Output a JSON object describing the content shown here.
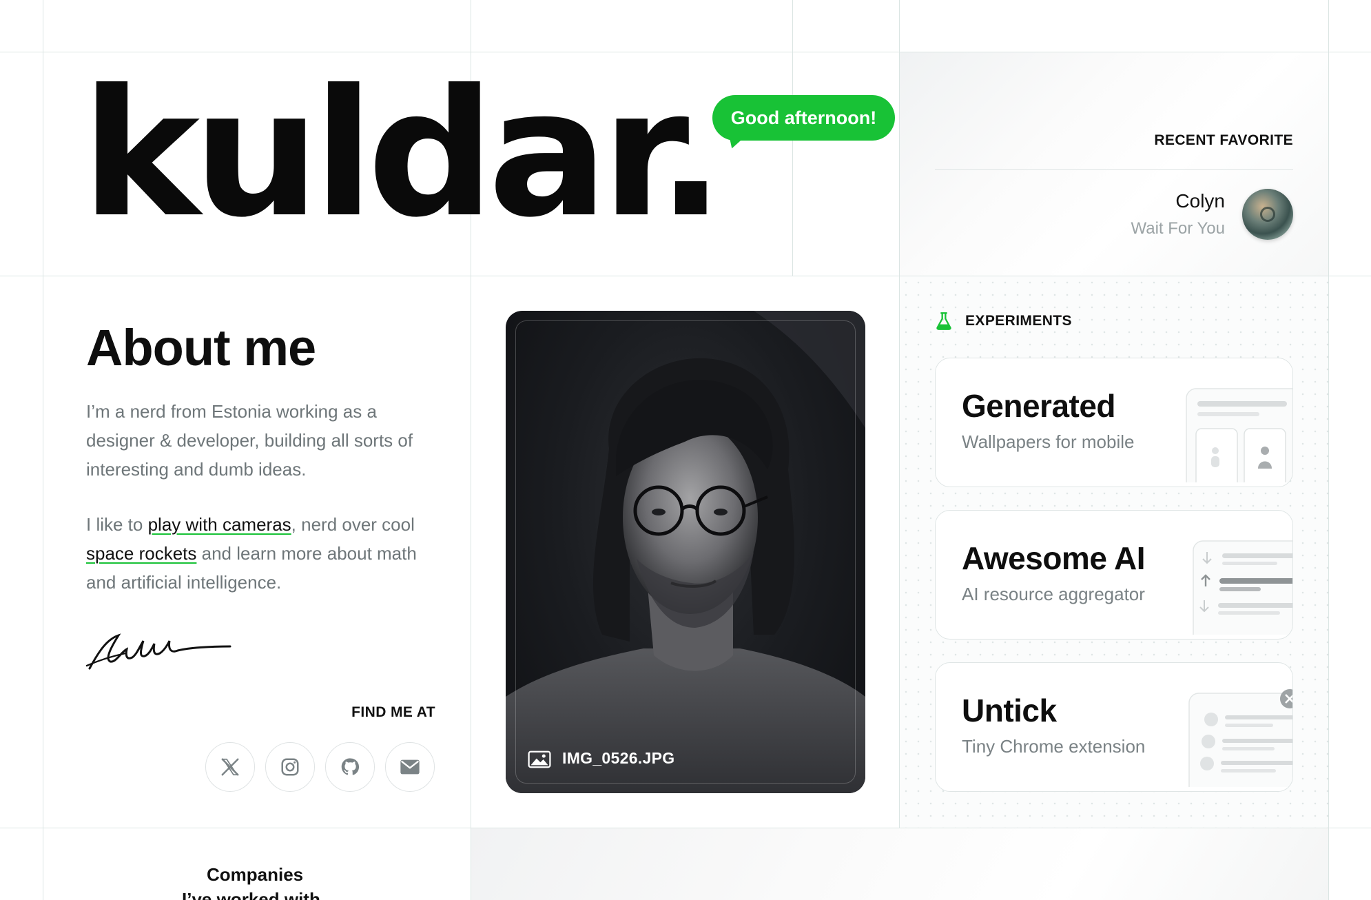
{
  "header": {
    "logo": "kuldar.",
    "greeting": "Good afternoon!"
  },
  "recent_favorite": {
    "label": "RECENT FAVORITE",
    "song": "Colyn",
    "artist": "Wait For You"
  },
  "about": {
    "title": "About me",
    "intro": "I’m a nerd from Estonia working as a designer & developer, building all sorts of interesting and dumb ideas.",
    "p2_before": "I like to ",
    "p2_link1": "play with cameras",
    "p2_middle": ", nerd over cool ",
    "p2_link2": "space rockets",
    "p2_after": " and learn more about math and artificial intelligence.",
    "find_me_label": "FIND ME AT",
    "socials": [
      "x-icon",
      "instagram-icon",
      "github-icon",
      "mail-icon"
    ]
  },
  "photo": {
    "caption": "IMG_0526.JPG"
  },
  "experiments": {
    "label": "EXPERIMENTS",
    "items": [
      {
        "title": "Generated",
        "subtitle": "Wallpapers for mobile"
      },
      {
        "title": "Awesome AI",
        "subtitle": "AI resource aggregator"
      },
      {
        "title": "Untick",
        "subtitle": "Tiny Chrome extension"
      }
    ]
  },
  "companies": {
    "title_line1": "Companies",
    "title_line2": "I’ve worked with"
  },
  "colors": {
    "accent": "#18c236",
    "grid_line": "#dbe5e3",
    "text_muted": "#6e7679"
  }
}
